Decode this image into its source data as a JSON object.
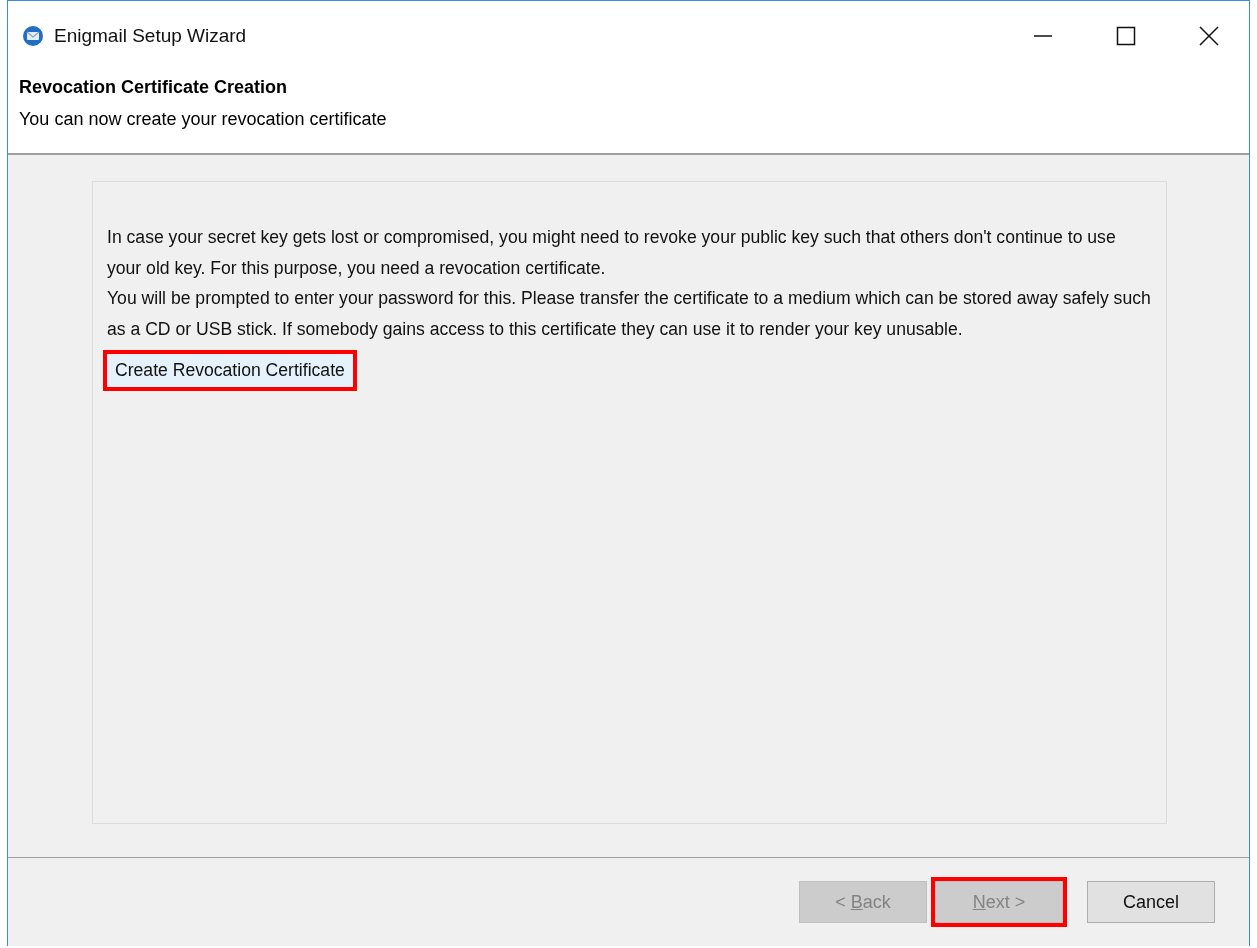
{
  "window": {
    "title": "Enigmail Setup Wizard"
  },
  "header": {
    "title": "Revocation Certificate Creation",
    "subtitle": "You can now create your revocation certificate"
  },
  "content": {
    "paragraphs": [
      "In case your secret key gets lost or compromised, you might need to revoke your public key such that others don't continue to use your old key. For this purpose, you need a revocation certificate.",
      "You will be prompted to enter your password for this. Please transfer the certificate to a medium which can be stored away safely such as a CD or USB stick. If somebody gains access to this certificate they can use it to render your key unusable."
    ],
    "action": {
      "label": "Create Revocation Certificate",
      "highlighted": true
    }
  },
  "buttons": [
    {
      "before": "< ",
      "key": "B",
      "after": "ack",
      "disabled": true,
      "highlighted": false
    },
    {
      "key": "N",
      "after": "ext >",
      "disabled": true,
      "highlighted": true
    },
    {
      "before": "Cancel",
      "disabled": false,
      "highlighted": false
    }
  ]
}
